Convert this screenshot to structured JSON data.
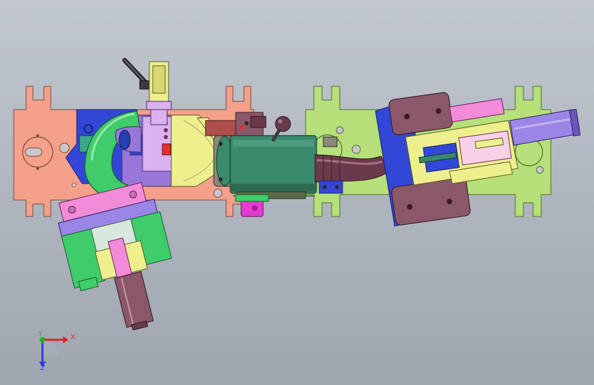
{
  "viewport": {
    "background_top": "#c2c7cf",
    "background_bottom": "#9fa6b0"
  },
  "model": {
    "parts": [
      "left-base-plate",
      "right-base-plate",
      "blue-mount-block",
      "green-bent-pipe",
      "purple-clamp-body",
      "yellow-cone-housing",
      "teal-cylinder-body",
      "dark-hose",
      "left-angled-cylinder-assembly",
      "right-cylinder-assembly",
      "top-toggle-clamp",
      "pink-lug"
    ],
    "colors": {
      "salmon_plate": "#f4a08a",
      "green_plate": "#b5e07a",
      "blue": "#3347d6",
      "green_pipe": "#3fcc6a",
      "purple": "#9877d8",
      "yellow": "#eef08e",
      "teal": "#3a8a6c",
      "hose": "#6a3a4c",
      "maroon": "#8a5868",
      "pink": "#f28cd9",
      "violet": "#9a86e6",
      "magenta": "#e63ad0"
    }
  },
  "triad": {
    "x_label": "X",
    "y_label": "Y",
    "z_label": "Z",
    "x_color": "#e02020",
    "y_color": "#22b022",
    "z_color": "#2840d8"
  }
}
